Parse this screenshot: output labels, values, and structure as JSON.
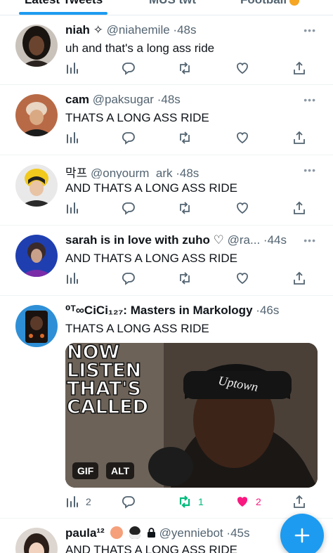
{
  "tabs": [
    {
      "label": "Latest Tweets",
      "active": true
    },
    {
      "label": "MUS twt",
      "active": false
    },
    {
      "label": "Football",
      "active": false
    }
  ],
  "more_label": "•••",
  "tweets": [
    {
      "name": "niah ✧",
      "handle": "@niahemile",
      "sep": "·",
      "time": "48s",
      "text": "uh and that's a long ass ride"
    },
    {
      "name": "cam",
      "handle": "@paksugar",
      "sep": "·",
      "time": "48s",
      "text": "THATS A LONG ASS RIDE"
    },
    {
      "name": "막프",
      "handle": "@onyourm_ark",
      "sep": "·",
      "time": "48s",
      "text": "AND THATS A LONG ASS RIDE"
    },
    {
      "name": "sarah is in love with zuho ♡",
      "handle": "@ra...",
      "sep": "·",
      "time": "44s",
      "text": "AND THATS A LONG ASS RIDE"
    },
    {
      "name": "⁰ᵀ∞CiCi₁₂₇: Masters in Markology",
      "handle": "",
      "sep": "·",
      "time": "46s",
      "text": "THATS A LONG ASS RIDE",
      "media": {
        "caption_lines": [
          "NOW",
          "LISTEN",
          "THAT'S",
          "CALLED"
        ],
        "hat_text": "Uptown",
        "gif_badge": "GIF",
        "alt_badge": "ALT"
      },
      "counts": {
        "views": "2",
        "retweets": "1",
        "likes": "2"
      }
    },
    {
      "name": "paula¹²",
      "handle": "@yenniebot",
      "sep": "·",
      "time": "45s",
      "text": "AND THATS A LONG ASS RIDE"
    }
  ],
  "colors": {
    "accent": "#1d9bf0",
    "retweet": "#00ba7c",
    "like": "#f91880",
    "muted": "#536471"
  }
}
